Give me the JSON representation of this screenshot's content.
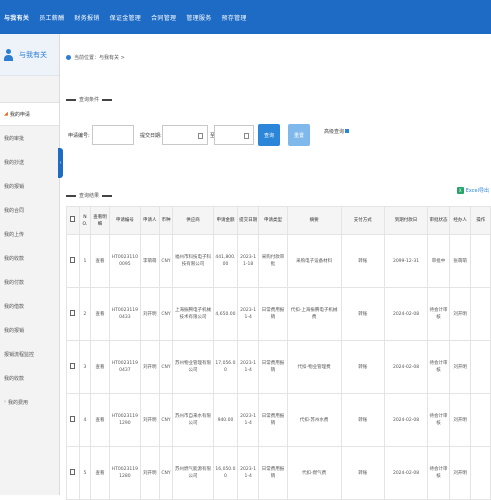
{
  "topnav": {
    "items": [
      "与我有关",
      "员工薪酬",
      "财务报销",
      "保证金管理",
      "合同管理",
      "管理服务",
      "预存管理"
    ]
  },
  "sidebar": {
    "title": "与我有关",
    "items": [
      "我的申请",
      "我的审批",
      "我的抄送",
      "我的报销",
      "我的合同",
      "我的上传",
      "我的收款",
      "我的付款",
      "我的借款",
      "我的报销",
      "报销流程监控",
      "我的收款",
      "我的费用"
    ]
  },
  "breadcrumb": "当前位置：与我有关 >",
  "query": {
    "section_title": "查询条件",
    "apply_no_label": "申请编号:",
    "apply_no_value": "",
    "date_label": "提交日期:",
    "date_sep": "至",
    "search_label": "查询",
    "reset_label": "重置",
    "advanced_label": "高级查询"
  },
  "results": {
    "section_title": "查询结果",
    "export_label": "Excel导出"
  },
  "table": {
    "headers": [
      "",
      "NO.",
      "查看明细",
      "申请编号",
      "申请人",
      "币种",
      "供应商",
      "申请金额",
      "提交日期",
      "申请类型",
      "摘要",
      "支付方式",
      "到期付款日",
      "审批状态",
      "经办人",
      "操作"
    ],
    "rows": [
      {
        "no": "1",
        "view": "查看",
        "code": "HT00231100095",
        "applicant": "李萌萌",
        "currency": "CNY",
        "vendor": "福州市科技电子科技有限公司",
        "amount": "441,800.00",
        "date": "2023-11-18",
        "type": "采购付款审批",
        "summary": "采购电子设备材料",
        "pay": "转账",
        "due": "2099-12-31",
        "status": "审批中",
        "handler": "张萌萌",
        "op": ""
      },
      {
        "no": "2",
        "view": "查看",
        "code": "HT00231190433",
        "applicant": "刘开明",
        "currency": "CNY",
        "vendor": "上海振腾电子机械技术有限公司",
        "amount": "4,650.00",
        "date": "2023-11-4",
        "type": "日常费用报销",
        "summary": "代扣-上海振腾电子机械费",
        "pay": "转账",
        "due": "2024-02-08",
        "status": "待会计审核",
        "handler": "刘开明",
        "op": ""
      },
      {
        "no": "3",
        "view": "查看",
        "code": "HT00231190437",
        "applicant": "刘开明",
        "currency": "CNY",
        "vendor": "苏州物业管理有限公司",
        "amount": "17,056.00",
        "date": "2023-11-4",
        "type": "日常费用报销",
        "summary": "代扣-物业管理费",
        "pay": "转账",
        "due": "2024-02-08",
        "status": "待会计审核",
        "handler": "刘开明",
        "op": ""
      },
      {
        "no": "4",
        "view": "查看",
        "code": "HT00231191290",
        "applicant": "刘开明",
        "currency": "CNY",
        "vendor": "苏州市自来水有限公司",
        "amount": "940.00",
        "date": "2023-11-4",
        "type": "日常费用报销",
        "summary": "代扣-苏州水费",
        "pay": "转账",
        "due": "2024-02-08",
        "status": "待会计审核",
        "handler": "刘开明",
        "op": ""
      },
      {
        "no": "5",
        "view": "查看",
        "code": "HT00231191280",
        "applicant": "刘开明",
        "currency": "CNY",
        "vendor": "苏州燃气能源有限公司",
        "amount": "16,050.00",
        "date": "2023-11-4",
        "type": "日常费用报销",
        "summary": "代扣-燃气费",
        "pay": "转账",
        "due": "2024-02-08",
        "status": "待会计审核",
        "handler": "刘开明",
        "op": ""
      }
    ]
  },
  "colors": {
    "nav_bg": "#1d6bc4",
    "link": "#2b86d9",
    "accent_orange": "#e0661b",
    "export_green": "#2aa36b"
  }
}
